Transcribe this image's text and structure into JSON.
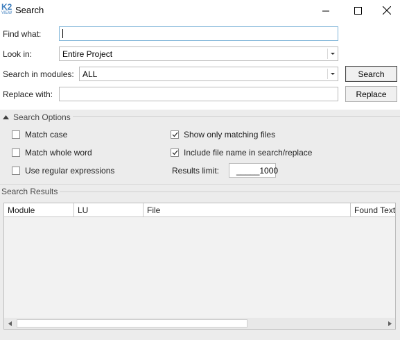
{
  "window": {
    "title": "Search",
    "logo_text": "K2",
    "logo_subtext": "VIEW"
  },
  "form": {
    "find_what_label": "Find what:",
    "find_what_value": "",
    "look_in_label": "Look in:",
    "look_in_value": "Entire Project",
    "search_modules_label": "Search in modules:",
    "search_modules_value": "ALL",
    "replace_with_label": "Replace with:",
    "replace_with_value": "",
    "search_button": "Search",
    "replace_button": "Replace"
  },
  "options": {
    "title": "Search Options",
    "match_case": {
      "label": "Match case",
      "checked": false
    },
    "match_whole_word": {
      "label": "Match whole word",
      "checked": false
    },
    "use_regex": {
      "label": "Use regular expressions",
      "checked": false
    },
    "show_only_matching": {
      "label": "Show only matching files",
      "checked": true
    },
    "include_file_name": {
      "label": "Include file name in search/replace",
      "checked": true
    },
    "results_limit_label": "Results limit:",
    "results_limit_value": "_____1000"
  },
  "results": {
    "title": "Search Results",
    "columns": [
      "Module",
      "LU",
      "File",
      "Found Text"
    ]
  },
  "icons": {
    "minimize": "minimize-icon",
    "maximize": "maximize-icon",
    "close": "close-icon",
    "collapse": "collapse-triangle-icon",
    "check": "checkmark-icon"
  }
}
